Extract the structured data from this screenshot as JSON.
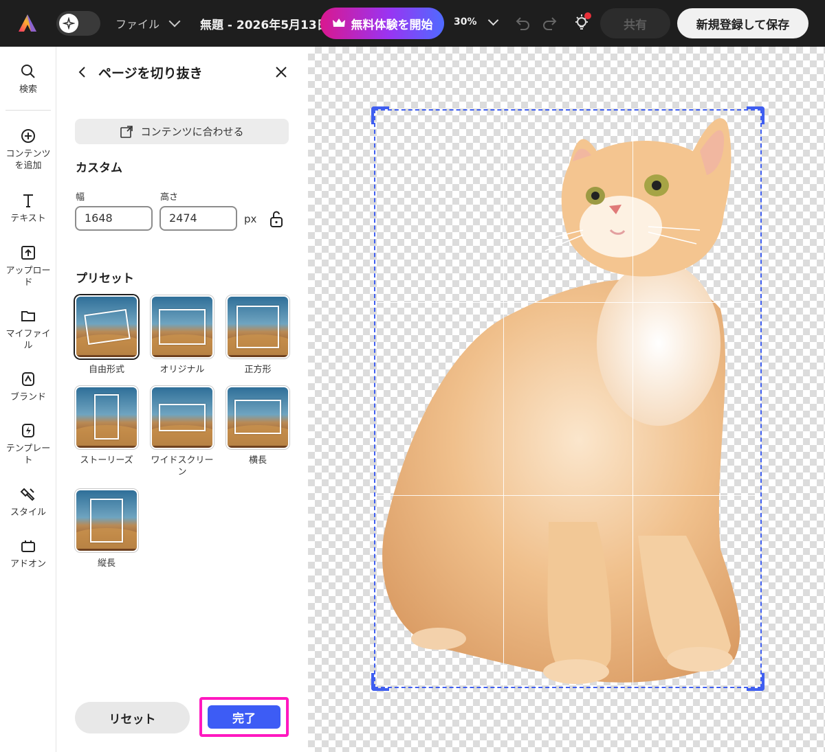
{
  "topbar": {
    "file_label": "ファイル",
    "doc_title": "無題 - 2026年5月13日",
    "trial_label": "無料体験を開始",
    "zoom_label": "30%",
    "share_label": "共有",
    "signup_label": "新規登録して保存"
  },
  "rail": {
    "items": [
      {
        "label": "検索",
        "icon": "search-icon"
      },
      {
        "label": "コンテンツを追加",
        "icon": "plus-circle-icon"
      },
      {
        "label": "テキスト",
        "icon": "text-icon"
      },
      {
        "label": "アップロード",
        "icon": "upload-icon"
      },
      {
        "label": "マイファイル",
        "icon": "folder-icon"
      },
      {
        "label": "ブランド",
        "icon": "brand-icon"
      },
      {
        "label": "テンプレート",
        "icon": "template-icon"
      },
      {
        "label": "スタイル",
        "icon": "style-icon"
      },
      {
        "label": "アドオン",
        "icon": "addon-icon"
      }
    ]
  },
  "panel": {
    "title": "ページを切り抜き",
    "fit_label": "コンテンツに合わせる",
    "custom_title": "カスタム",
    "width_label": "幅",
    "height_label": "高さ",
    "width_value": "1648",
    "height_value": "2474",
    "unit": "px",
    "presets_title": "プリセット",
    "presets": [
      {
        "label": "自由形式",
        "selected": true
      },
      {
        "label": "オリジナル",
        "selected": false
      },
      {
        "label": "正方形",
        "selected": false
      },
      {
        "label": "ストーリーズ",
        "selected": false
      },
      {
        "label": "ワイドスクリーン",
        "selected": false
      },
      {
        "label": "横長",
        "selected": false
      },
      {
        "label": "縦長",
        "selected": false
      }
    ],
    "reset_label": "リセット",
    "done_label": "完了"
  },
  "colors": {
    "accent": "#3d5cf5",
    "highlight": "#ff18c0",
    "topbar_bg": "#1e1e1e"
  }
}
